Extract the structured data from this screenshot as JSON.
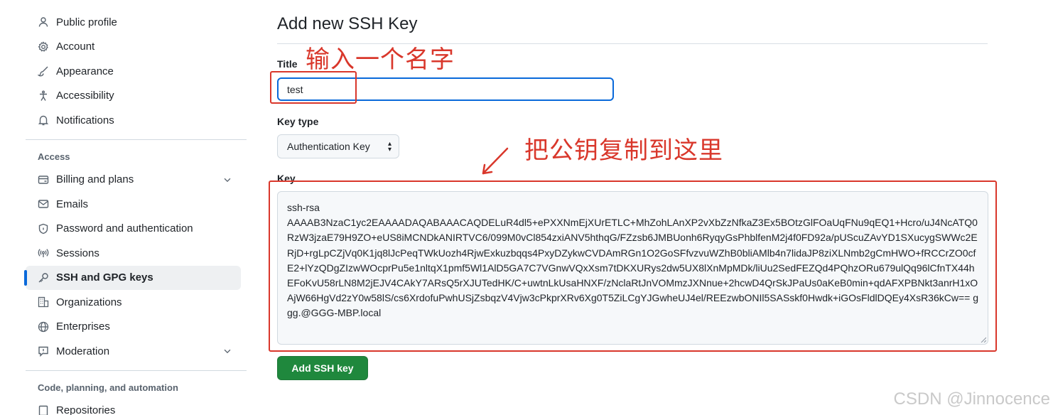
{
  "sidebar": {
    "items_top": [
      {
        "label": "Public profile",
        "icon": "person-icon"
      },
      {
        "label": "Account",
        "icon": "gear-icon"
      },
      {
        "label": "Appearance",
        "icon": "paintbrush-icon"
      },
      {
        "label": "Accessibility",
        "icon": "accessibility-icon"
      },
      {
        "label": "Notifications",
        "icon": "bell-icon"
      }
    ],
    "access_title": "Access",
    "items_access": [
      {
        "label": "Billing and plans",
        "icon": "credit-card-icon",
        "expandable": true
      },
      {
        "label": "Emails",
        "icon": "mail-icon"
      },
      {
        "label": "Password and authentication",
        "icon": "shield-lock-icon"
      },
      {
        "label": "Sessions",
        "icon": "broadcast-icon"
      },
      {
        "label": "SSH and GPG keys",
        "icon": "key-icon",
        "active": true
      },
      {
        "label": "Organizations",
        "icon": "organization-icon"
      },
      {
        "label": "Enterprises",
        "icon": "globe-icon"
      },
      {
        "label": "Moderation",
        "icon": "report-icon",
        "expandable": true
      }
    ],
    "code_title": "Code, planning, and automation",
    "items_code": [
      {
        "label": "Repositories",
        "icon": "repo-icon"
      }
    ]
  },
  "main": {
    "title": "Add new SSH Key",
    "title_label": "Title",
    "title_value": "test",
    "key_type_label": "Key type",
    "key_type_value": "Authentication Key",
    "key_label": "Key",
    "key_value": "ssh-rsa\nAAAAB3NzaC1yc2EAAAADAQABAAACAQDELuR4dl5+ePXXNmEjXUrETLC+MhZohLAnXP2vXbZzNfkaZ3Ex5BOtzGlFOaUqFNu9qEQ1+Hcro/uJ4NcATQ0RzW3jzaE79H9ZO+eUS8iMCNDkANIRTVC6/099M0vCl854zxiANV5hthqG/FZzsb6JMBUonh6RyqyGsPhblfenM2j4f0FD92a/pUScuZAvYD1SXucygSWWc2ERjD+rgLpCZjVq0K1jq8lJcPeqTWkUozh4RjwExkuzbqqs4PxyDZykwCVDAmRGn1O2GoSFfvzvuWZhB0bliAMlb4n7lidaJP8ziXLNmb2gCmHWO+fRCCrZO0cfE2+lYzQDgZIzwWOcprPu5e1nltqX1pmf5Wl1AlD5GA7C7VGnwVQxXsm7tDKXURys2dw5UX8lXnMpMDk/liUu2SedFEZQd4PQhzORu679ulQq96lCfnTX44hEFoKvU58rLN8M2jEJV4CAkY7ARsQ5rXJUTedHK/C+uwtnLkUsaHNXF/zNclaRtJnVOMmzJXNnue+2hcwD4QrSkJPaUs0aKeB0min+qdAFXPBNkt3anrH1xOAjW66HgVd2zY0w58lS/cs6XrdofuPwhUSjZsbqzV4Vjw3cPkprXRv6Xg0T5ZiLCgYJGwheUJ4el/REEzwbONIl5SASskf0Hwdk+iGOsFldlDQEy4XsR36kCw== ggg.@GGG-MBP.local",
    "submit_label": "Add SSH key"
  },
  "annotations": {
    "name_hint": "输入一个名字",
    "key_hint": "把公钥复制到这里",
    "color": "#d9372b"
  },
  "watermark": "CSDN @Jinnocence",
  "colors": {
    "accent": "#0969da",
    "primary_button": "#1f883d"
  }
}
